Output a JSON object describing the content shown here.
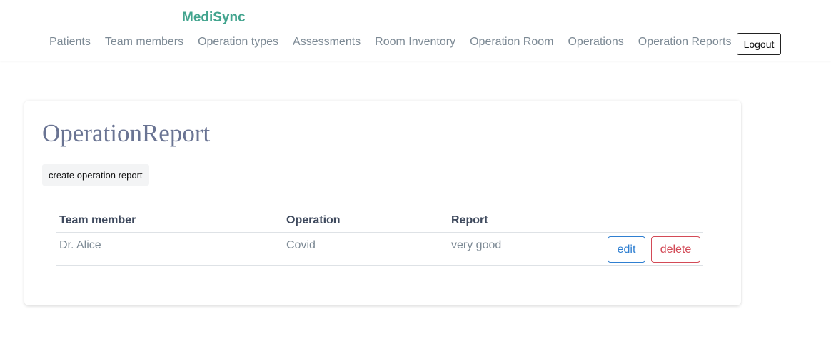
{
  "navbar": {
    "brand": "MediSync",
    "links": [
      {
        "label": "Patients"
      },
      {
        "label": "Team members"
      },
      {
        "label": "Operation types"
      },
      {
        "label": "Assessments"
      },
      {
        "label": "Room Inventory"
      },
      {
        "label": "Operation Room"
      },
      {
        "label": "Operations"
      },
      {
        "label": "Operation Reports"
      }
    ],
    "logout_label": "Logout"
  },
  "main": {
    "title": "OperationReport",
    "create_label": "create operation report",
    "table": {
      "headers": [
        "Team member",
        "Operation",
        "Report"
      ],
      "rows": [
        {
          "team_member": "Dr. Alice",
          "operation": "Covid",
          "report": "very good",
          "edit_label": "edit",
          "delete_label": "delete"
        }
      ]
    }
  },
  "colors": {
    "brand": "#42a48e",
    "nav_text": "#7d8a95",
    "title": "#6a7493",
    "edit": "#2f7fd1",
    "delete": "#d34a57"
  }
}
